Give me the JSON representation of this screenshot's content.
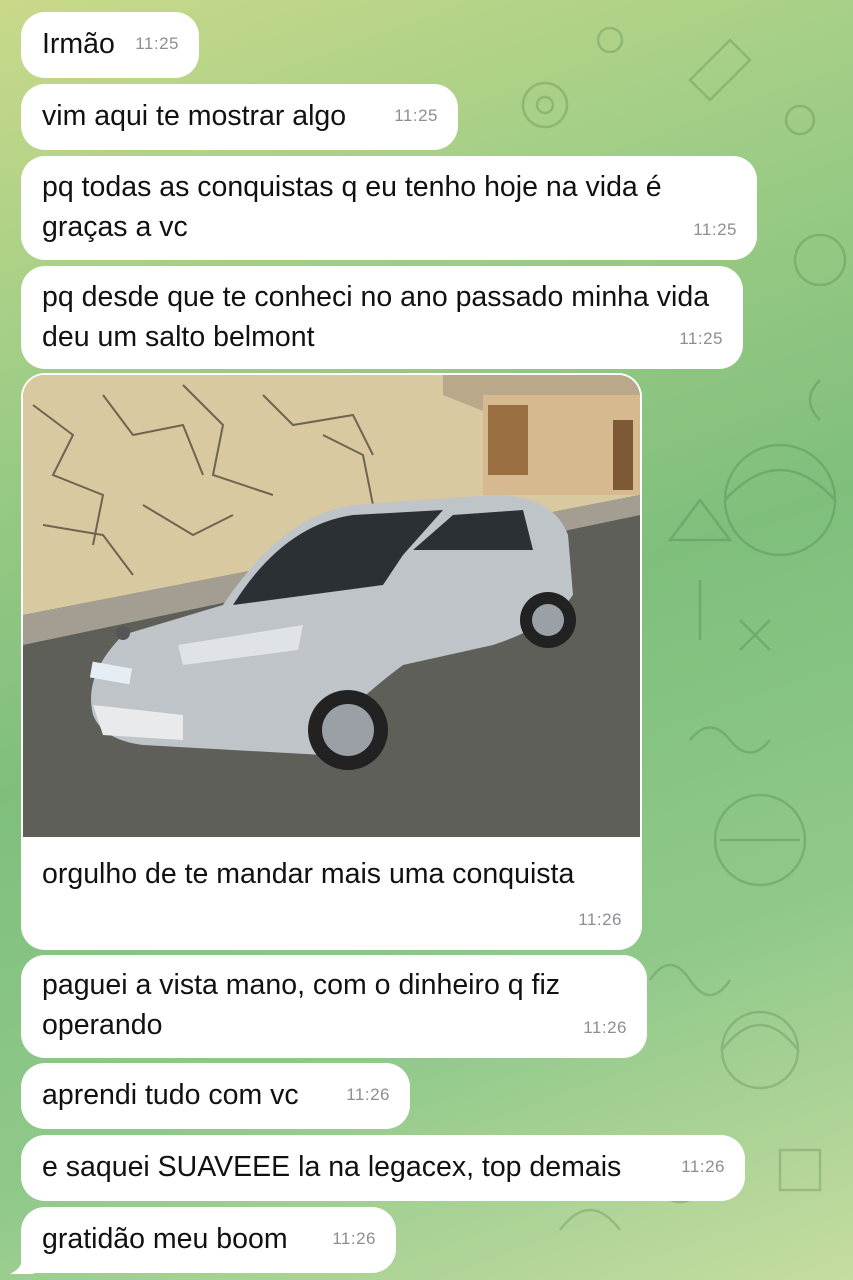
{
  "messages": [
    {
      "text": "Irmão",
      "time": "11:25"
    },
    {
      "text": "vim aqui te mostrar algo",
      "time": "11:25"
    },
    {
      "text": "pq todas as conquistas q eu tenho hoje na vida é graças a vc",
      "time": "11:25"
    },
    {
      "text": "pq desde que te conheci no ano passado minha vida deu um salto belmont",
      "time": "11:25"
    },
    {
      "text": "orgulho de te mandar mais uma conquista",
      "time": "11:26",
      "has_photo": true
    },
    {
      "text": "paguei a vista mano, com o dinheiro q fiz operando",
      "time": "11:26"
    },
    {
      "text": "aprendi tudo com vc",
      "time": "11:26"
    },
    {
      "text": "e saquei SUAVEEE la na legacex, top demais",
      "time": "11:26"
    },
    {
      "text": "gratidão meu boom",
      "time": "11:26"
    }
  ],
  "colors": {
    "bubble": "#ffffff",
    "time": "#8e8e93",
    "background_accent": "#7fbf7c"
  }
}
